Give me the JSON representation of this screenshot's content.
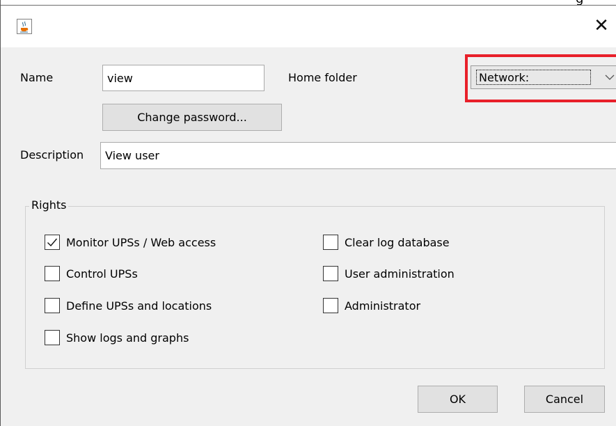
{
  "window": {
    "clipped_title_fragment": "g",
    "close_glyph": "✕"
  },
  "form": {
    "name_label": "Name",
    "name_value": "view",
    "home_folder_label": "Home folder",
    "home_folder_value": "Network:",
    "change_password_label": "Change password...",
    "description_label": "Description",
    "description_value": "View user"
  },
  "rights": {
    "title": "Rights",
    "items": [
      {
        "label": "Monitor UPSs / Web access",
        "checked": true
      },
      {
        "label": "Control UPSs",
        "checked": false
      },
      {
        "label": "Define UPSs and locations",
        "checked": false
      },
      {
        "label": "Show logs and graphs",
        "checked": false
      },
      {
        "label": "Clear log database",
        "checked": false
      },
      {
        "label": "User administration",
        "checked": false
      },
      {
        "label": "Administrator",
        "checked": false
      }
    ]
  },
  "buttons": {
    "ok": "OK",
    "cancel": "Cancel"
  },
  "icons": {
    "app": "java-cup-icon",
    "close": "close-icon",
    "dropdown": "chevron-down-icon",
    "check": "check-icon"
  },
  "colors": {
    "highlight": "#e8202a",
    "dialog_bg": "#f0f0f0",
    "button_bg": "#e1e1e1"
  }
}
